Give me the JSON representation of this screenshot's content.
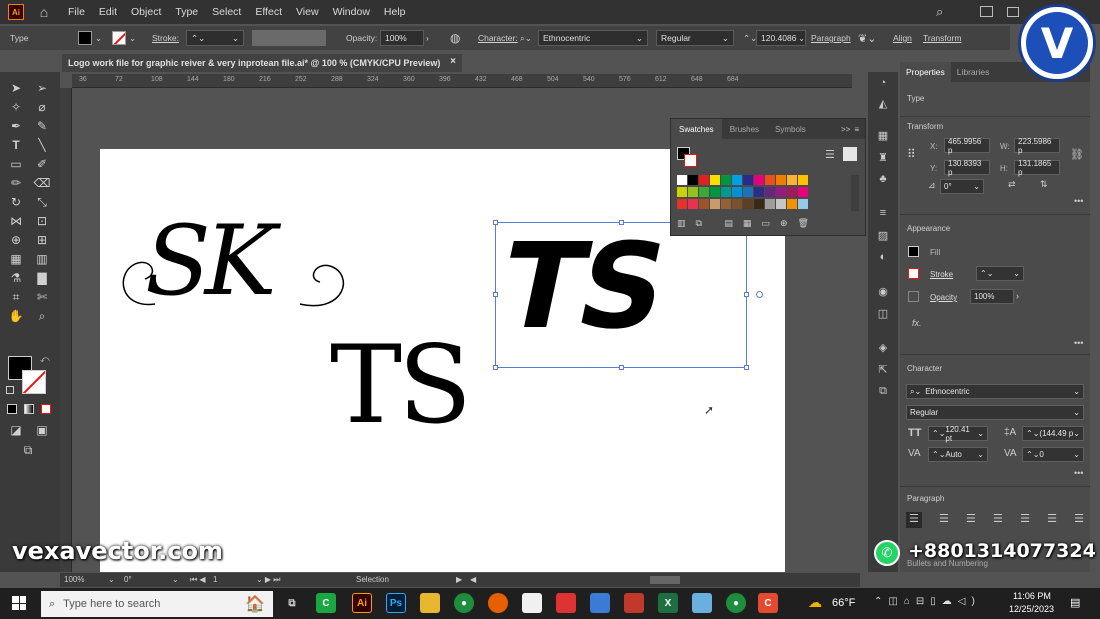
{
  "menu": {
    "app_icon": "Ai",
    "items": [
      "File",
      "Edit",
      "Object",
      "Type",
      "Select",
      "Effect",
      "View",
      "Window",
      "Help"
    ]
  },
  "control": {
    "type_label": "Type",
    "stroke_label": "Stroke:",
    "opacity_label": "Opacity:",
    "opacity_value": "100%",
    "character_label": "Character:",
    "font_family": "Ethnocentric",
    "font_style": "Regular",
    "font_size": "120.4086",
    "paragraph_label": "Paragraph",
    "align_label": "Align",
    "transform_label": "Transform"
  },
  "document": {
    "tab_title": "Logo work file for graphic reiver & very inprotean file.ai* @ 100 % (CMYK/CPU Preview)",
    "close_glyph": "×"
  },
  "ruler": {
    "ticks": [
      "36",
      "72",
      "108",
      "144",
      "180",
      "216",
      "252",
      "288",
      "324",
      "360",
      "396",
      "432",
      "468",
      "504",
      "540",
      "576",
      "612",
      "648",
      "684"
    ]
  },
  "artwork": {
    "logo_sk": "SK",
    "logo_ts_serif": "TS",
    "logo_ts_selected": "TS"
  },
  "swatches": {
    "tabs": [
      "Swatches",
      "Brushes",
      "Symbols"
    ],
    "expand_glyph": ">>",
    "colors": [
      "#ffffff",
      "#000000",
      "#e31e24",
      "#f7e000",
      "#009640",
      "#00a0e3",
      "#2a2a8a",
      "#e5007e",
      "#e94e1b",
      "#ef7d00",
      "#f9b233",
      "#fdc300",
      "#cbd200",
      "#95c11f",
      "#3aaa35",
      "#00963f",
      "#009a93",
      "#0093d3",
      "#1d71b8",
      "#2d2e83",
      "#662483",
      "#951b81",
      "#a3195b",
      "#e6007e",
      "#e6332a",
      "#e73351",
      "#a0522d",
      "#c69c6d",
      "#936037",
      "#7a5230",
      "#5d4023",
      "#3b2818",
      "#9d9d9c",
      "#c6c6c6",
      "#f39200",
      "#97c9ea"
    ]
  },
  "properties": {
    "tabs": [
      "Properties",
      "Libraries"
    ],
    "type_heading": "Type",
    "transform_heading": "Transform",
    "x_label": "X:",
    "x_value": "465.9956 p",
    "w_label": "W:",
    "w_value": "223.5986 p",
    "y_label": "Y:",
    "y_value": "130.8393 p",
    "h_label": "H:",
    "h_value": "131.1865 p",
    "angle_value": "0°",
    "appearance_heading": "Appearance",
    "fill_label": "Fill",
    "stroke_label": "Stroke",
    "opacity_label": "Opacity",
    "opacity_value": "100%",
    "fx_label": "fx.",
    "character_heading": "Character",
    "font_family": "Ethnocentric",
    "font_style": "Regular",
    "font_size": "120.41 pt",
    "leading": "(144.49 p",
    "tracking": "Auto",
    "kerning": "0",
    "paragraph_heading": "Paragraph",
    "bullets_label": "Bullets and Numbering"
  },
  "status": {
    "zoom": "100%",
    "rotation": "0°",
    "artboard_index": "1",
    "tool": "Selection"
  },
  "taskbar": {
    "search_placeholder": "Type here to search",
    "weather": "66°F",
    "time": "11:06 PM",
    "date": "12/25/2023"
  },
  "overlay": {
    "website": "vexavector.com",
    "phone": "+8801314077324",
    "logo_letter": "V"
  }
}
